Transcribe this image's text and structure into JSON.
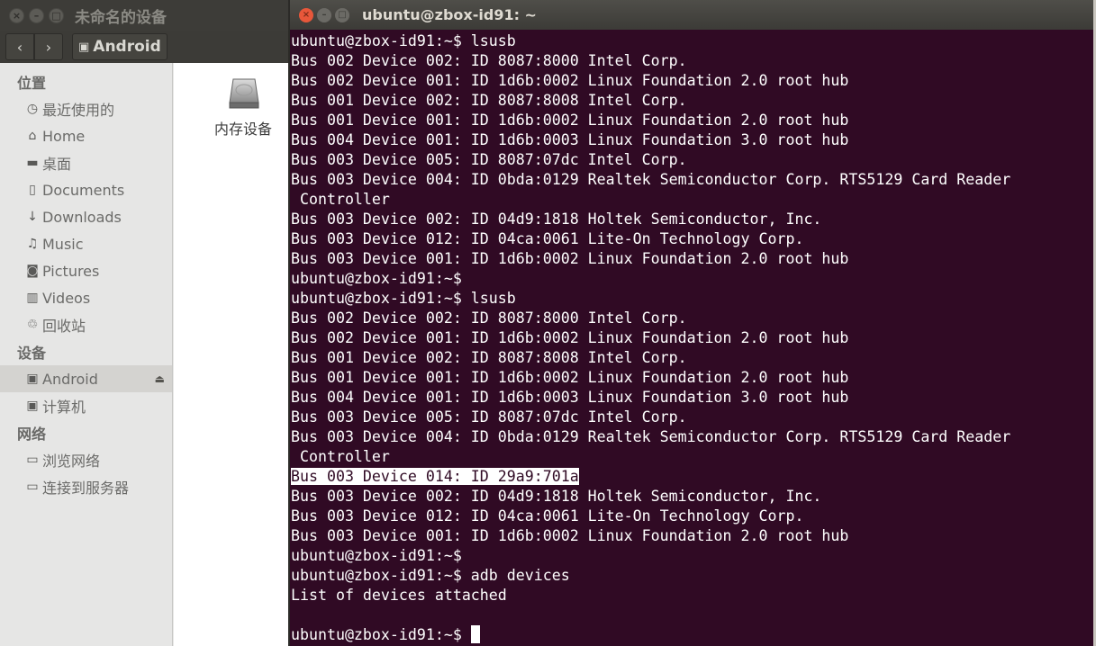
{
  "file_manager": {
    "title": "未命名的设备",
    "window_buttons": [
      "close",
      "minimize",
      "maximize"
    ],
    "nav": {
      "back_icon": "‹",
      "forward_icon": "›"
    },
    "path": {
      "icon": "drive-icon",
      "label": "Android"
    },
    "sidebar": {
      "sections": [
        {
          "title": "位置",
          "items": [
            {
              "icon": "clock-icon",
              "glyph": "◷",
              "label": "最近使用的"
            },
            {
              "icon": "home-icon",
              "glyph": "⌂",
              "label": "Home"
            },
            {
              "icon": "folder-icon",
              "glyph": "▬",
              "label": "桌面"
            },
            {
              "icon": "document-icon",
              "glyph": "▯",
              "label": "Documents"
            },
            {
              "icon": "download-icon",
              "glyph": "↓",
              "label": "Downloads"
            },
            {
              "icon": "music-icon",
              "glyph": "♫",
              "label": "Music"
            },
            {
              "icon": "camera-icon",
              "glyph": "◙",
              "label": "Pictures"
            },
            {
              "icon": "film-icon",
              "glyph": "▥",
              "label": "Videos"
            },
            {
              "icon": "trash-icon",
              "glyph": "♲",
              "label": "回收站"
            }
          ]
        },
        {
          "title": "设备",
          "items": [
            {
              "icon": "drive-icon",
              "glyph": "▣",
              "label": "Android",
              "active": true,
              "eject": "⏏"
            },
            {
              "icon": "computer-icon",
              "glyph": "▣",
              "label": "计算机"
            }
          ]
        },
        {
          "title": "网络",
          "items": [
            {
              "icon": "network-icon",
              "glyph": "▭",
              "label": "浏览网络"
            },
            {
              "icon": "server-icon",
              "glyph": "▭",
              "label": "连接到服务器"
            }
          ]
        }
      ]
    },
    "content": {
      "items": [
        {
          "icon": "harddisk-icon",
          "label": "内存设备"
        }
      ]
    }
  },
  "terminal": {
    "title": "ubuntu@zbox-id91: ~",
    "lines": [
      "ubuntu@zbox-id91:~$ lsusb",
      "Bus 002 Device 002: ID 8087:8000 Intel Corp.",
      "Bus 002 Device 001: ID 1d6b:0002 Linux Foundation 2.0 root hub",
      "Bus 001 Device 002: ID 8087:8008 Intel Corp.",
      "Bus 001 Device 001: ID 1d6b:0002 Linux Foundation 2.0 root hub",
      "Bus 004 Device 001: ID 1d6b:0003 Linux Foundation 3.0 root hub",
      "Bus 003 Device 005: ID 8087:07dc Intel Corp.",
      "Bus 003 Device 004: ID 0bda:0129 Realtek Semiconductor Corp. RTS5129 Card Reader",
      " Controller",
      "Bus 003 Device 002: ID 04d9:1818 Holtek Semiconductor, Inc.",
      "Bus 003 Device 012: ID 04ca:0061 Lite-On Technology Corp.",
      "Bus 003 Device 001: ID 1d6b:0002 Linux Foundation 2.0 root hub",
      "ubuntu@zbox-id91:~$",
      "ubuntu@zbox-id91:~$ lsusb",
      "Bus 002 Device 002: ID 8087:8000 Intel Corp.",
      "Bus 002 Device 001: ID 1d6b:0002 Linux Foundation 2.0 root hub",
      "Bus 001 Device 002: ID 8087:8008 Intel Corp.",
      "Bus 001 Device 001: ID 1d6b:0002 Linux Foundation 2.0 root hub",
      "Bus 004 Device 001: ID 1d6b:0003 Linux Foundation 3.0 root hub",
      "Bus 003 Device 005: ID 8087:07dc Intel Corp.",
      "Bus 003 Device 004: ID 0bda:0129 Realtek Semiconductor Corp. RTS5129 Card Reader",
      " Controller",
      "Bus 003 Device 014: ID 29a9:701a",
      "Bus 003 Device 002: ID 04d9:1818 Holtek Semiconductor, Inc.",
      "Bus 003 Device 012: ID 04ca:0061 Lite-On Technology Corp.",
      "Bus 003 Device 001: ID 1d6b:0002 Linux Foundation 2.0 root hub",
      "ubuntu@zbox-id91:~$",
      "ubuntu@zbox-id91:~$ adb devices",
      "List of devices attached",
      ""
    ],
    "highlighted_line_index": 22,
    "prompt": "ubuntu@zbox-id91:~$ ",
    "colors": {
      "background": "#300a24",
      "foreground": "#ffffff",
      "close_button": "#e8573a"
    }
  }
}
